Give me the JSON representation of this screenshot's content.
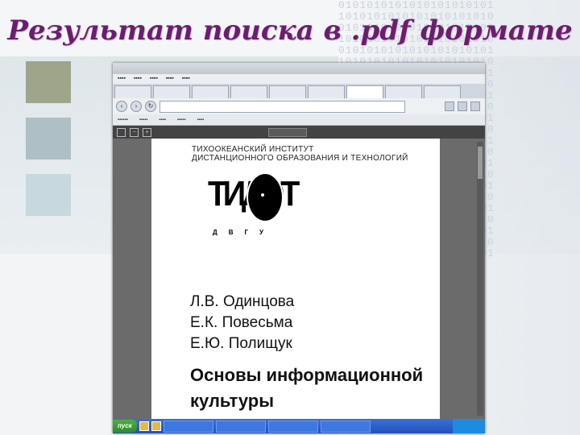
{
  "slide": {
    "title": "Результат поиска в .pdf формате",
    "binary_pattern": "0101010101010101010101\n1010101010101010101010\n0101010101010101010101\n1010101010101010101010\n0101010101010101010101\n1010101010101010101010\n0101010101010101010101\n1010101010101010101010\n0101010101010101010101\n1010101010101010101010\n0101010101010101010101\n1010101010101010101010\n0101010101010101010101\n1010101010101010101010\n0101010101010101010101\n1010101010101010101010\n0101010101010101010101\n1010101010101010101010\n0101010101010101010101\n1010101010101010101010\n0101010101010101010101\n1010101010101010101010\n0101010101010101010101"
  },
  "pdf_page": {
    "institute_name": "ТИХООКЕАНСКИЙ ИНСТИТУТ\nДИСТАНЦИОННОГО ОБРАЗОВАНИЯ И ТЕХНОЛОГИЙ",
    "logo_letters": "ТИДОТ",
    "logo_subtitle": "ДВГУ",
    "authors": [
      "Л.В. Одинцова",
      "Е.К. Повесьма",
      "Е.Ю. Полищук"
    ],
    "book_title": "Основы информационной культуры"
  },
  "taskbar": {
    "start_label": "пуск"
  }
}
